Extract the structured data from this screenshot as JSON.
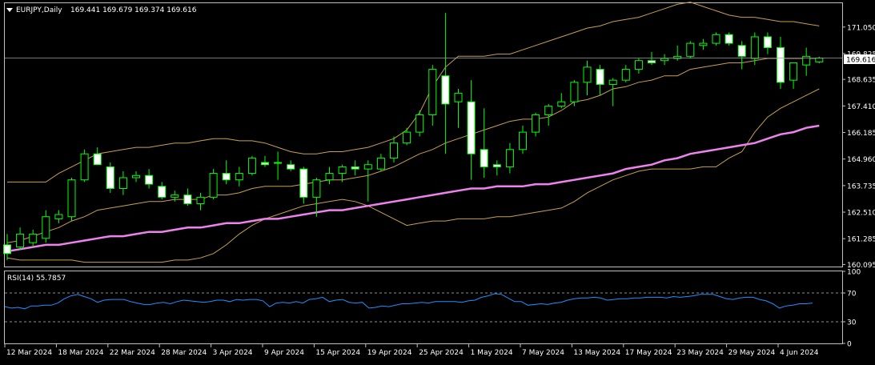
{
  "chart_data": [
    {
      "type": "candlestick",
      "title": "EURJPY,Daily",
      "ohlc_header": "169.441 169.679 169.374 169.616",
      "current_price_label": "169.616",
      "y_ticks": [
        "171.050",
        "169.825",
        "168.635",
        "167.410",
        "166.185",
        "164.960",
        "163.735",
        "162.510",
        "161.285",
        "160.095"
      ],
      "y_tick_values": [
        171.05,
        169.825,
        168.635,
        167.41,
        166.185,
        164.96,
        163.735,
        162.51,
        161.285,
        160.095
      ],
      "ylim": [
        160.0,
        172.15
      ],
      "x_ticks": [
        "12 Mar 2024",
        "18 Mar 2024",
        "22 Mar 2024",
        "28 Mar 2024",
        "3 Apr 2024",
        "9 Apr 2024",
        "15 Apr 2024",
        "19 Apr 2024",
        "25 Apr 2024",
        "1 May 2024",
        "7 May 2024",
        "13 May 2024",
        "17 May 2024",
        "23 May 2024",
        "29 May 2024",
        "4 Jun 2024"
      ],
      "x_tick_bar_index": [
        0,
        4,
        8,
        12,
        16,
        20,
        24,
        28,
        32,
        36,
        40,
        44,
        48,
        52,
        56,
        60
      ],
      "candles": [
        {
          "o": 161.0,
          "h": 161.5,
          "l": 160.3,
          "c": 160.6
        },
        {
          "o": 160.9,
          "h": 161.8,
          "l": 160.8,
          "c": 161.5
        },
        {
          "o": 161.1,
          "h": 161.7,
          "l": 160.9,
          "c": 161.5
        },
        {
          "o": 161.3,
          "h": 162.6,
          "l": 161.1,
          "c": 162.3
        },
        {
          "o": 162.2,
          "h": 162.6,
          "l": 162.0,
          "c": 162.4
        },
        {
          "o": 162.3,
          "h": 164.1,
          "l": 162.1,
          "c": 164.0
        },
        {
          "o": 164.0,
          "h": 165.4,
          "l": 163.9,
          "c": 165.2
        },
        {
          "o": 165.2,
          "h": 165.5,
          "l": 164.8,
          "c": 164.7
        },
        {
          "o": 164.6,
          "h": 164.8,
          "l": 163.4,
          "c": 163.6
        },
        {
          "o": 163.6,
          "h": 164.4,
          "l": 163.3,
          "c": 164.1
        },
        {
          "o": 164.1,
          "h": 164.4,
          "l": 163.9,
          "c": 164.2
        },
        {
          "o": 164.2,
          "h": 164.5,
          "l": 163.6,
          "c": 163.8
        },
        {
          "o": 163.7,
          "h": 163.9,
          "l": 163.1,
          "c": 163.2
        },
        {
          "o": 163.2,
          "h": 163.5,
          "l": 163.0,
          "c": 163.3
        },
        {
          "o": 163.3,
          "h": 163.6,
          "l": 162.8,
          "c": 162.9
        },
        {
          "o": 162.9,
          "h": 163.4,
          "l": 162.6,
          "c": 163.2
        },
        {
          "o": 163.2,
          "h": 164.5,
          "l": 163.1,
          "c": 164.3
        },
        {
          "o": 164.3,
          "h": 164.9,
          "l": 163.8,
          "c": 164.0
        },
        {
          "o": 164.0,
          "h": 164.6,
          "l": 163.7,
          "c": 164.3
        },
        {
          "o": 164.3,
          "h": 165.1,
          "l": 164.2,
          "c": 165.0
        },
        {
          "o": 164.8,
          "h": 165.1,
          "l": 164.6,
          "c": 164.7
        },
        {
          "o": 164.8,
          "h": 165.3,
          "l": 164.0,
          "c": 164.8
        },
        {
          "o": 164.7,
          "h": 164.9,
          "l": 164.4,
          "c": 164.5
        },
        {
          "o": 164.5,
          "h": 164.6,
          "l": 162.9,
          "c": 163.2
        },
        {
          "o": 163.2,
          "h": 164.1,
          "l": 162.3,
          "c": 164.0
        },
        {
          "o": 164.0,
          "h": 164.6,
          "l": 163.8,
          "c": 164.3
        },
        {
          "o": 164.3,
          "h": 164.7,
          "l": 163.9,
          "c": 164.6
        },
        {
          "o": 164.6,
          "h": 164.9,
          "l": 164.2,
          "c": 164.5
        },
        {
          "o": 164.5,
          "h": 164.9,
          "l": 163.0,
          "c": 164.7
        },
        {
          "o": 164.5,
          "h": 165.2,
          "l": 164.4,
          "c": 165.0
        },
        {
          "o": 165.0,
          "h": 166.0,
          "l": 164.8,
          "c": 165.7
        },
        {
          "o": 165.7,
          "h": 166.4,
          "l": 165.6,
          "c": 166.2
        },
        {
          "o": 166.2,
          "h": 167.2,
          "l": 166.0,
          "c": 167.0
        },
        {
          "o": 167.0,
          "h": 169.3,
          "l": 166.5,
          "c": 169.1
        },
        {
          "o": 168.8,
          "h": 171.7,
          "l": 165.2,
          "c": 167.5
        },
        {
          "o": 167.6,
          "h": 168.2,
          "l": 166.4,
          "c": 168.0
        },
        {
          "o": 167.6,
          "h": 168.6,
          "l": 164.0,
          "c": 165.2
        },
        {
          "o": 165.4,
          "h": 167.3,
          "l": 164.1,
          "c": 164.6
        },
        {
          "o": 164.7,
          "h": 164.9,
          "l": 164.2,
          "c": 164.6
        },
        {
          "o": 164.6,
          "h": 165.7,
          "l": 164.3,
          "c": 165.4
        },
        {
          "o": 165.4,
          "h": 166.5,
          "l": 165.2,
          "c": 166.2
        },
        {
          "o": 166.2,
          "h": 167.1,
          "l": 166.0,
          "c": 167.0
        },
        {
          "o": 167.0,
          "h": 167.5,
          "l": 166.5,
          "c": 167.4
        },
        {
          "o": 167.4,
          "h": 168.0,
          "l": 167.3,
          "c": 167.6
        },
        {
          "o": 167.6,
          "h": 168.6,
          "l": 167.4,
          "c": 168.5
        },
        {
          "o": 168.5,
          "h": 169.5,
          "l": 167.9,
          "c": 169.2
        },
        {
          "o": 169.1,
          "h": 169.3,
          "l": 167.9,
          "c": 168.4
        },
        {
          "o": 168.4,
          "h": 168.7,
          "l": 167.4,
          "c": 168.6
        },
        {
          "o": 168.6,
          "h": 169.3,
          "l": 168.5,
          "c": 169.1
        },
        {
          "o": 169.1,
          "h": 169.6,
          "l": 168.9,
          "c": 169.5
        },
        {
          "o": 169.5,
          "h": 169.9,
          "l": 169.3,
          "c": 169.4
        },
        {
          "o": 169.5,
          "h": 169.8,
          "l": 169.3,
          "c": 169.6
        },
        {
          "o": 169.6,
          "h": 170.2,
          "l": 169.5,
          "c": 169.7
        },
        {
          "o": 169.7,
          "h": 170.4,
          "l": 169.6,
          "c": 170.3
        },
        {
          "o": 170.2,
          "h": 170.5,
          "l": 170.0,
          "c": 170.3
        },
        {
          "o": 170.3,
          "h": 170.8,
          "l": 170.2,
          "c": 170.7
        },
        {
          "o": 170.7,
          "h": 170.8,
          "l": 170.2,
          "c": 170.3
        },
        {
          "o": 170.2,
          "h": 170.4,
          "l": 169.1,
          "c": 169.7
        },
        {
          "o": 169.6,
          "h": 170.8,
          "l": 169.3,
          "c": 170.6
        },
        {
          "o": 170.6,
          "h": 170.8,
          "l": 169.8,
          "c": 170.1
        },
        {
          "o": 170.1,
          "h": 170.6,
          "l": 168.2,
          "c": 168.5
        },
        {
          "o": 168.6,
          "h": 169.4,
          "l": 168.2,
          "c": 169.4
        },
        {
          "o": 169.3,
          "h": 170.1,
          "l": 168.8,
          "c": 169.7
        },
        {
          "o": 169.441,
          "h": 169.679,
          "l": 169.374,
          "c": 169.616
        }
      ],
      "bollinger_upper": [
        163.9,
        163.9,
        163.9,
        163.9,
        164.3,
        164.6,
        164.9,
        165.2,
        165.3,
        165.4,
        165.5,
        165.5,
        165.6,
        165.7,
        165.7,
        165.8,
        165.9,
        165.9,
        165.8,
        165.8,
        165.7,
        165.5,
        165.3,
        165.2,
        165.2,
        165.3,
        165.3,
        165.4,
        165.5,
        165.7,
        165.9,
        166.3,
        167.1,
        168.3,
        169.2,
        169.7,
        169.7,
        169.7,
        169.8,
        169.8,
        170.0,
        170.2,
        170.4,
        170.6,
        170.8,
        171.0,
        171.1,
        171.3,
        171.4,
        171.5,
        171.7,
        171.9,
        172.1,
        172.2,
        172.0,
        171.8,
        171.6,
        171.5,
        171.5,
        171.4,
        171.3,
        171.3,
        171.2,
        171.1
      ],
      "bollinger_middle": [
        161.1,
        161.2,
        161.4,
        161.6,
        161.8,
        162.1,
        162.3,
        162.6,
        162.7,
        162.8,
        162.9,
        163.0,
        163.0,
        163.1,
        163.1,
        163.1,
        163.3,
        163.3,
        163.4,
        163.6,
        163.7,
        163.7,
        163.7,
        163.8,
        163.9,
        164.0,
        164.0,
        164.1,
        164.2,
        164.4,
        164.6,
        164.9,
        165.2,
        165.4,
        165.7,
        165.9,
        166.1,
        166.3,
        166.5,
        166.7,
        166.8,
        166.8,
        166.9,
        167.2,
        167.6,
        167.7,
        167.9,
        168.2,
        168.3,
        168.5,
        168.6,
        168.8,
        168.8,
        169.1,
        169.2,
        169.3,
        169.4,
        169.4,
        169.5,
        169.6,
        169.6,
        169.6,
        169.6,
        169.6
      ],
      "bollinger_lower": [
        160.4,
        160.3,
        160.3,
        160.3,
        160.3,
        160.3,
        160.2,
        160.2,
        160.2,
        160.2,
        160.2,
        160.2,
        160.2,
        160.3,
        160.3,
        160.4,
        160.6,
        161.0,
        161.5,
        161.9,
        162.2,
        162.4,
        162.6,
        162.8,
        162.9,
        163.0,
        163.1,
        163.0,
        162.8,
        162.5,
        162.2,
        161.9,
        162.0,
        162.1,
        162.1,
        162.2,
        162.2,
        162.2,
        162.3,
        162.3,
        162.4,
        162.5,
        162.6,
        162.7,
        163.0,
        163.4,
        163.7,
        164.0,
        164.2,
        164.4,
        164.5,
        164.5,
        164.5,
        164.5,
        164.6,
        164.6,
        165.0,
        165.3,
        166.2,
        166.9,
        167.3,
        167.6,
        167.9,
        168.2
      ],
      "ma_long": [
        160.7,
        160.8,
        160.9,
        161.0,
        161.0,
        161.1,
        161.2,
        161.3,
        161.4,
        161.4,
        161.5,
        161.6,
        161.6,
        161.7,
        161.8,
        161.8,
        161.9,
        162.0,
        162.0,
        162.1,
        162.2,
        162.2,
        162.3,
        162.4,
        162.5,
        162.6,
        162.6,
        162.7,
        162.8,
        162.9,
        163.0,
        163.1,
        163.2,
        163.3,
        163.4,
        163.5,
        163.6,
        163.6,
        163.7,
        163.7,
        163.7,
        163.8,
        163.8,
        163.9,
        164.0,
        164.1,
        164.2,
        164.3,
        164.5,
        164.6,
        164.7,
        164.9,
        165.0,
        165.2,
        165.3,
        165.4,
        165.5,
        165.6,
        165.7,
        165.9,
        166.1,
        166.2,
        166.4,
        166.5
      ]
    },
    {
      "type": "line",
      "title": "RSI(14) 55.7857",
      "y_ticks": [
        "100",
        "70",
        "30",
        "0"
      ],
      "y_tick_values": [
        100,
        70,
        30,
        0
      ],
      "ylim": [
        0,
        100
      ],
      "levels": [
        70,
        30
      ],
      "values": [
        51,
        49,
        50,
        48,
        52,
        52,
        53,
        53,
        56,
        62,
        66,
        68,
        65,
        62,
        57,
        60,
        61,
        61,
        61,
        58,
        56,
        54,
        54,
        56,
        57,
        55,
        58,
        60,
        59,
        58,
        57,
        58,
        60,
        60,
        58,
        61,
        60,
        61,
        61,
        59,
        51,
        56,
        57,
        56,
        58,
        56,
        61,
        62,
        64,
        58,
        60,
        61,
        57,
        56,
        57,
        49,
        50,
        52,
        51,
        53,
        55,
        55,
        56,
        57,
        56,
        58,
        58,
        58,
        58,
        57,
        59,
        60,
        64,
        66,
        69,
        68,
        63,
        58,
        58,
        53,
        54,
        55,
        54,
        56,
        57,
        60,
        62,
        63,
        63,
        64,
        63,
        60,
        61,
        62,
        62,
        63,
        63,
        64,
        64,
        64,
        63,
        65,
        64,
        65,
        66,
        68,
        68,
        68,
        65,
        62,
        61,
        63,
        64,
        64,
        61,
        59,
        55,
        49,
        52,
        53,
        55,
        55,
        56
      ]
    }
  ]
}
